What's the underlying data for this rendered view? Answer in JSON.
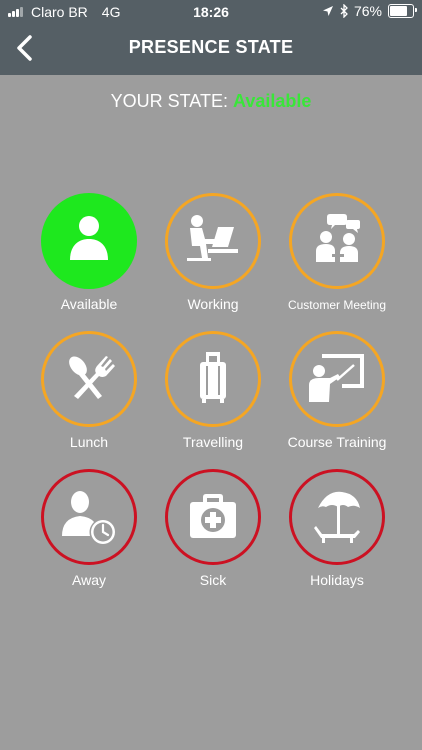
{
  "status_bar": {
    "carrier": "Claro BR",
    "network": "4G",
    "time": "18:26",
    "battery": "76%",
    "battery_level": 0.76
  },
  "header": {
    "title": "PRESENCE STATE",
    "back_icon": "chevron-left-icon"
  },
  "current_state": {
    "prefix": "YOUR STATE:",
    "value": "Available"
  },
  "colors": {
    "header_bg": "#555f65",
    "page_bg": "#9d9d9d",
    "available_green": "#1ee81e",
    "busy_orange": "#f5a623",
    "unavailable_red": "#cc1122"
  },
  "states": [
    {
      "label": "Available",
      "icon": "person-icon",
      "status": "green"
    },
    {
      "label": "Working",
      "icon": "laptop-worker-icon",
      "status": "orange"
    },
    {
      "label": "Customer Meeting",
      "icon": "meeting-icon",
      "status": "orange"
    },
    {
      "label": "Lunch",
      "icon": "fork-spoon-icon",
      "status": "orange"
    },
    {
      "label": "Travelling",
      "icon": "suitcase-icon",
      "status": "orange"
    },
    {
      "label": "Course Training",
      "icon": "presentation-board-icon",
      "status": "orange"
    },
    {
      "label": "Away",
      "icon": "person-clock-icon",
      "status": "red"
    },
    {
      "label": "Sick",
      "icon": "first-aid-kit-icon",
      "status": "red"
    },
    {
      "label": "Holidays",
      "icon": "beach-umbrella-icon",
      "status": "red"
    }
  ]
}
